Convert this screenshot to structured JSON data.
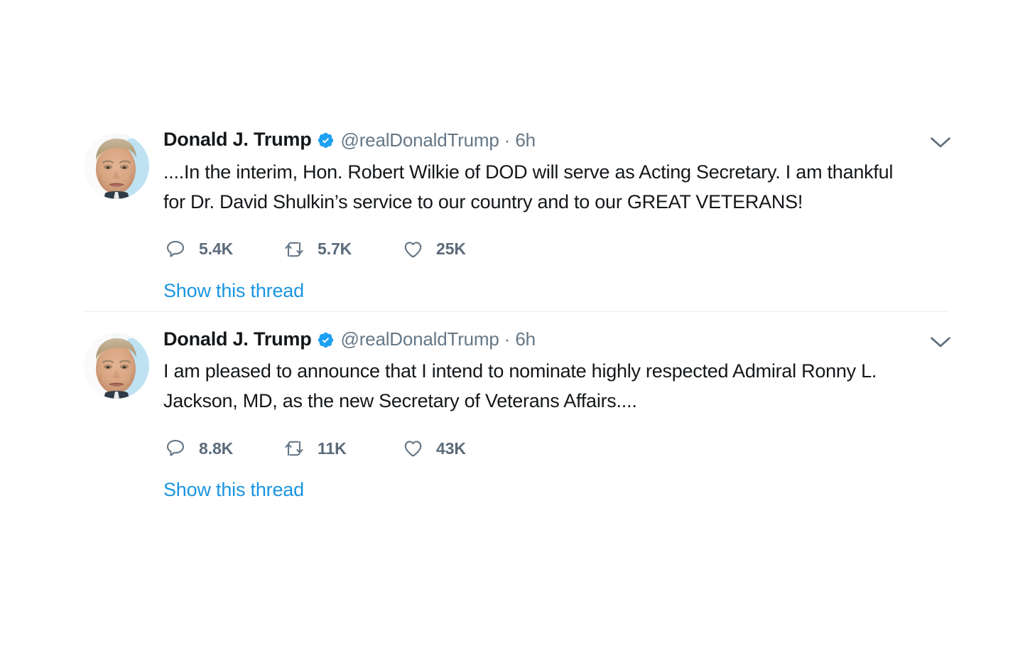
{
  "page": {
    "background": "#ffffff",
    "accent_blue": "#1b95e0",
    "verified_blue": "#1da1f2",
    "muted_gray": "#657786",
    "text_dark": "#14171a",
    "metric_gray": "#5b6b7a",
    "divider": "#eef0f1"
  },
  "tweets": [
    {
      "avatar_alt": "Donald J. Trump profile photo",
      "display_name": "Donald J. Trump",
      "verified_icon": "verified-badge-icon",
      "handle": "@realDonaldTrump",
      "separator": "·",
      "timestamp": "6h",
      "caret_icon": "chevron-down-icon",
      "text": "....In the interim, Hon. Robert Wilkie of DOD will serve as Acting Secretary. I am thankful for Dr. David Shulkin’s service to our country and to our GREAT VETERANS!",
      "actions": {
        "reply": {
          "icon": "reply-icon",
          "count": "5.4K"
        },
        "retweet": {
          "icon": "retweet-icon",
          "count": "5.7K"
        },
        "like": {
          "icon": "heart-icon",
          "count": "25K"
        }
      },
      "show_thread": "Show this thread"
    },
    {
      "avatar_alt": "Donald J. Trump profile photo",
      "display_name": "Donald J. Trump",
      "verified_icon": "verified-badge-icon",
      "handle": "@realDonaldTrump",
      "separator": "·",
      "timestamp": "6h",
      "caret_icon": "chevron-down-icon",
      "text": "I am pleased to announce that I intend to nominate highly respected Admiral Ronny L. Jackson, MD, as the new Secretary of Veterans Affairs....",
      "actions": {
        "reply": {
          "icon": "reply-icon",
          "count": "8.8K"
        },
        "retweet": {
          "icon": "retweet-icon",
          "count": "11K"
        },
        "like": {
          "icon": "heart-icon",
          "count": "43K"
        }
      },
      "show_thread": "Show this thread"
    }
  ]
}
